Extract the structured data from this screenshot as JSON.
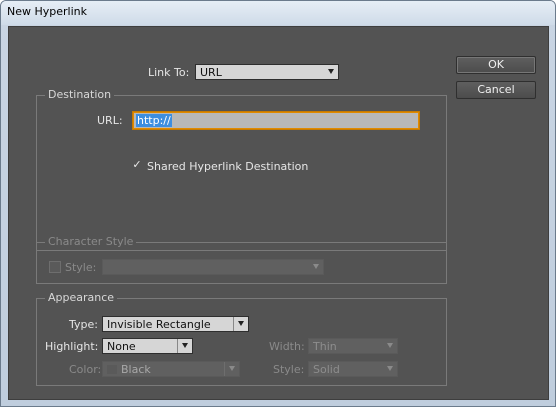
{
  "window": {
    "title": "New Hyperlink"
  },
  "link_to": {
    "label": "Link To:",
    "value": "URL"
  },
  "destination": {
    "group_label": "Destination",
    "url_label": "URL:",
    "url_value": "http://",
    "shared_label": "Shared Hyperlink Destination",
    "shared_checked": true
  },
  "character_style": {
    "group_label": "Character Style",
    "style_label": "Style:",
    "style_value": ""
  },
  "appearance": {
    "group_label": "Appearance",
    "type_label": "Type:",
    "type_value": "Invisible Rectangle",
    "highlight_label": "Highlight:",
    "highlight_value": "None",
    "color_label": "Color:",
    "color_value": "Black",
    "width_label": "Width:",
    "width_value": "Thin",
    "style_label": "Style:",
    "style_value": "Solid"
  },
  "buttons": {
    "ok": "OK",
    "cancel": "Cancel"
  },
  "colors": {
    "panel": "#535353",
    "focus_border": "#e08a00",
    "selection": "#3d8ee0"
  },
  "icons": {
    "check": "checkmark-icon",
    "dropdown": "chevron-down-icon"
  }
}
